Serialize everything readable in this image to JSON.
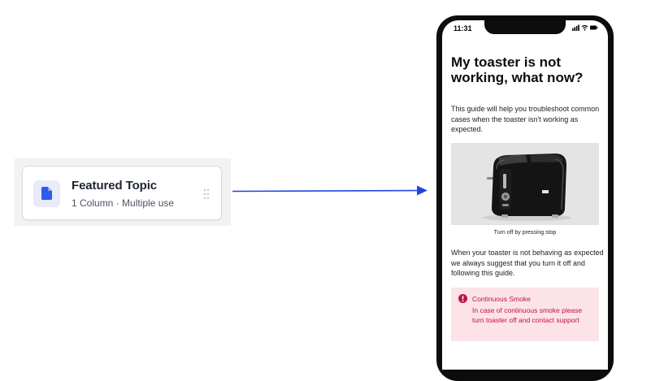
{
  "component_card": {
    "title": "Featured Topic",
    "subtitle": "1 Column · Multiple use",
    "icon": "document-icon",
    "accent_color": "#2f5bea"
  },
  "phone": {
    "status_bar": {
      "time": "11:31",
      "icons": [
        "signal-icon",
        "wifi-icon",
        "battery-icon"
      ]
    },
    "article": {
      "title": "My toaster is not working, what now?",
      "intro": "This guide will help you troubleshoot common cases when the toaster isn't working as expected.",
      "image_caption": "Turn off by pressing stop",
      "body": "When your toaster is not behaving as expected we always suggest that you turn it off and following this guide.",
      "alert": {
        "title": "Continuous Smoke",
        "message": "In case of continuous smoke please turn toaster off and contact support",
        "color": "#c0124a",
        "background": "#fbe3e7"
      }
    }
  },
  "arrow_color": "#2146e0"
}
